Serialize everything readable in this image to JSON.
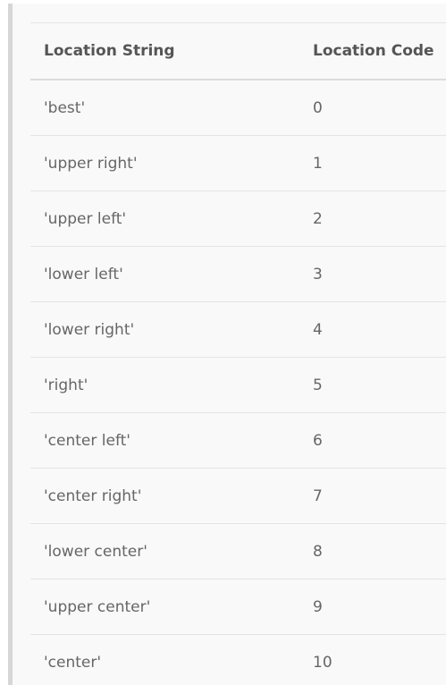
{
  "table": {
    "headers": [
      "Location String",
      "Location Code"
    ],
    "rows": [
      [
        "'best'",
        "0"
      ],
      [
        "'upper right'",
        "1"
      ],
      [
        "'upper left'",
        "2"
      ],
      [
        "'lower left'",
        "3"
      ],
      [
        "'lower right'",
        "4"
      ],
      [
        "'right'",
        "5"
      ],
      [
        "'center left'",
        "6"
      ],
      [
        "'center right'",
        "7"
      ],
      [
        "'lower center'",
        "8"
      ],
      [
        "'upper center'",
        "9"
      ],
      [
        "'center'",
        "10"
      ]
    ]
  }
}
